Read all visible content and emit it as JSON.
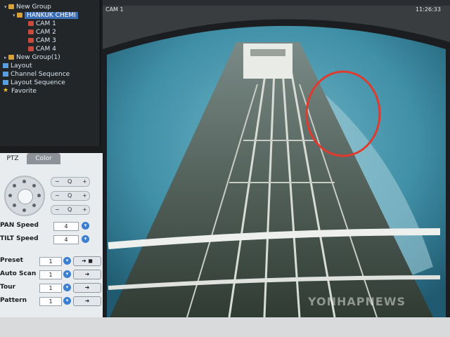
{
  "tree": {
    "items": [
      {
        "label": "New Group",
        "type": "folder"
      },
      {
        "label": "HANKUK CHEMI",
        "type": "folder",
        "selected": true
      },
      {
        "label": "CAM 1",
        "type": "camera"
      },
      {
        "label": "CAM 2",
        "type": "camera"
      },
      {
        "label": "CAM 3",
        "type": "camera"
      },
      {
        "label": "CAM 4",
        "type": "camera"
      },
      {
        "label": "New Group(1)",
        "type": "folder"
      },
      {
        "label": "Layout",
        "type": "layout"
      },
      {
        "label": "Channel Sequence",
        "type": "sequence"
      },
      {
        "label": "Layout Sequence",
        "type": "sequence"
      },
      {
        "label": "Favorite",
        "type": "favorite"
      }
    ]
  },
  "ptz": {
    "tabs": [
      "PTZ",
      "Color"
    ],
    "zoom_buttons": [
      "Q",
      "Q",
      "Q"
    ],
    "pan_speed_label": "PAN Speed",
    "pan_speed_value": "4",
    "tilt_speed_label": "TILT Speed",
    "tilt_speed_value": "4",
    "preset_label": "Preset",
    "preset_value": "1",
    "auto_scan_label": "Auto Scan",
    "auto_scan_value": "1",
    "tour_label": "Tour",
    "tour_value": "1",
    "pattern_label": "Pattern",
    "pattern_value": "1"
  },
  "video": {
    "camera_label": "CAM 1",
    "timestamp": "11:26:33",
    "watermark": "YONHAPNEWS"
  },
  "colors": {
    "annotation_circle": "#e03a2f",
    "sea": "#3f8fa6",
    "deck": "#3a4a3f"
  }
}
